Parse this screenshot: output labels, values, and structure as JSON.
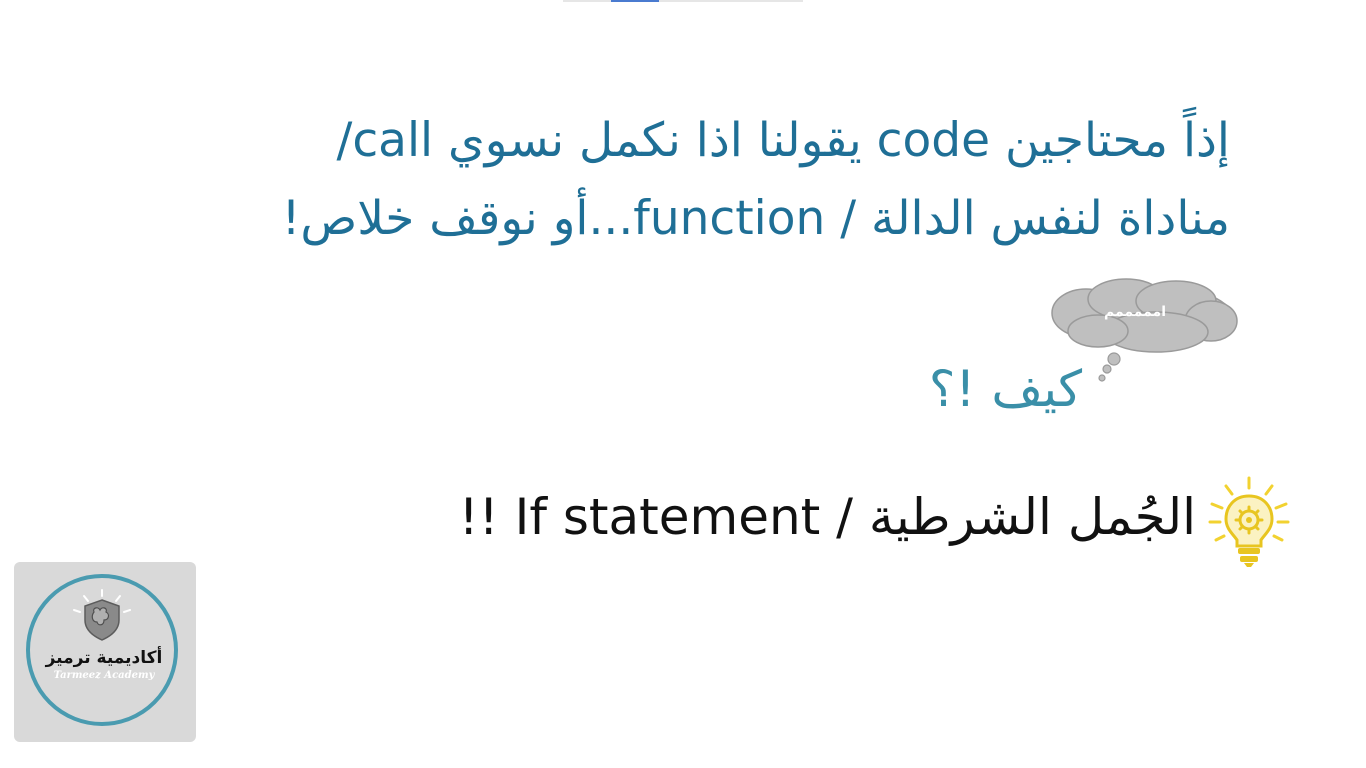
{
  "slide": {
    "heading_line1": "إذاً محتاجين code يقولنا اذا نكمل نسوي call/",
    "heading_line2": "مناداة لنفس الدالة / function...أو نوقف خلاص!",
    "thought_bubble": "امممممم",
    "question": "كيف !؟",
    "answer": "الجُمل الشرطية / If statement !!"
  },
  "logo": {
    "title": "أكاديمية ترميز",
    "subtitle": "Tarmeez Academy"
  },
  "icons": {
    "bulb": "lightbulb-gear-icon",
    "brain": "brain-icon"
  },
  "colors": {
    "heading": "#1f6f96",
    "question": "#3a8fa8",
    "cloud": "#bfbfbf",
    "bulb": "#f2d230",
    "logo_ring": "#4a9bb0"
  }
}
